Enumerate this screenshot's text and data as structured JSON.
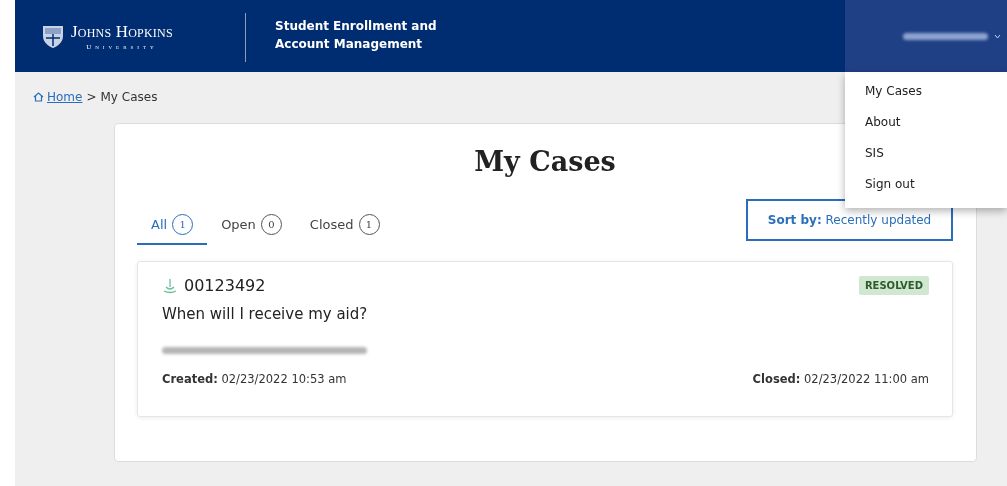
{
  "header": {
    "logo_name": "Johns Hopkins",
    "logo_sub": "University",
    "app_title": [
      "Student Enrollment and",
      "Account Management"
    ],
    "user_menu": {
      "expanded": true
    }
  },
  "user_menu_items": [
    "My Cases",
    "About",
    "SIS",
    "Sign out"
  ],
  "breadcrumb": {
    "home": "Home",
    "separator": ">",
    "current": "My Cases"
  },
  "page_title": "My Cases",
  "tabs": [
    {
      "label": "All",
      "count": "1",
      "selected": true
    },
    {
      "label": "Open",
      "count": "0",
      "selected": false
    },
    {
      "label": "Closed",
      "count": "1",
      "selected": false
    }
  ],
  "sort": {
    "label": "Sort by:",
    "value": "Recently updated"
  },
  "cases": [
    {
      "number": "00123492",
      "status": "RESOLVED",
      "subject": "When will I receive my aid?",
      "created_label": "Created:",
      "created": "02/23/2022 10:53 am",
      "closed_label": "Closed:",
      "closed": "02/23/2022 11:00 am"
    }
  ]
}
